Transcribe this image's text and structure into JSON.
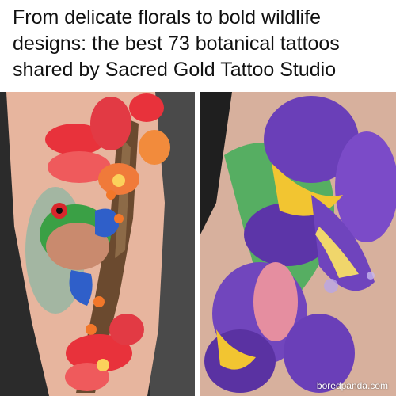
{
  "headline": "From delicate florals to bold wildlife designs: the best 73 botanical tattoos shared by Sacred Gold Tattoo Studio",
  "watermark": "boredpanda.com",
  "images": {
    "left": {
      "icon": "orchid-tree-frog-leg-tattoo",
      "colors": {
        "background": "#262626",
        "skin": "#e8b9a0",
        "orchid": "#e8323b",
        "frog": "#3aa045",
        "bark": "#6b4a2f"
      }
    },
    "right": {
      "icon": "purple-iris-arm-tattoo",
      "colors": {
        "background": "#2a2a2a",
        "skin": "#d9b4a0",
        "iris": "#6a3fb8",
        "yellow": "#f2c531",
        "leaf": "#48a55a"
      }
    }
  }
}
